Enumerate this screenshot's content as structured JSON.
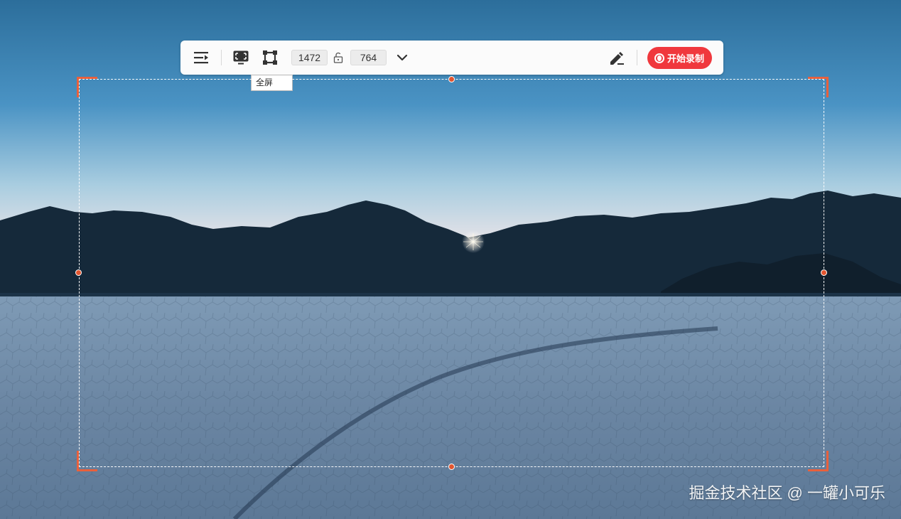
{
  "toolbar": {
    "icons": [
      "menu-expand-icon",
      "fullscreen-icon",
      "region-select-icon",
      "lock-ratio-icon",
      "chevron-down-icon",
      "annotate-pen-icon",
      "record-icon"
    ],
    "width_value": "1472",
    "height_value": "764",
    "record_label": "开始录制",
    "record_color": "#f0383d"
  },
  "tooltip": {
    "text": "全屏"
  },
  "selection": {
    "accent_color": "#e8603c"
  },
  "watermark": {
    "text": "掘金技术社区 @ 一罐小可乐"
  }
}
